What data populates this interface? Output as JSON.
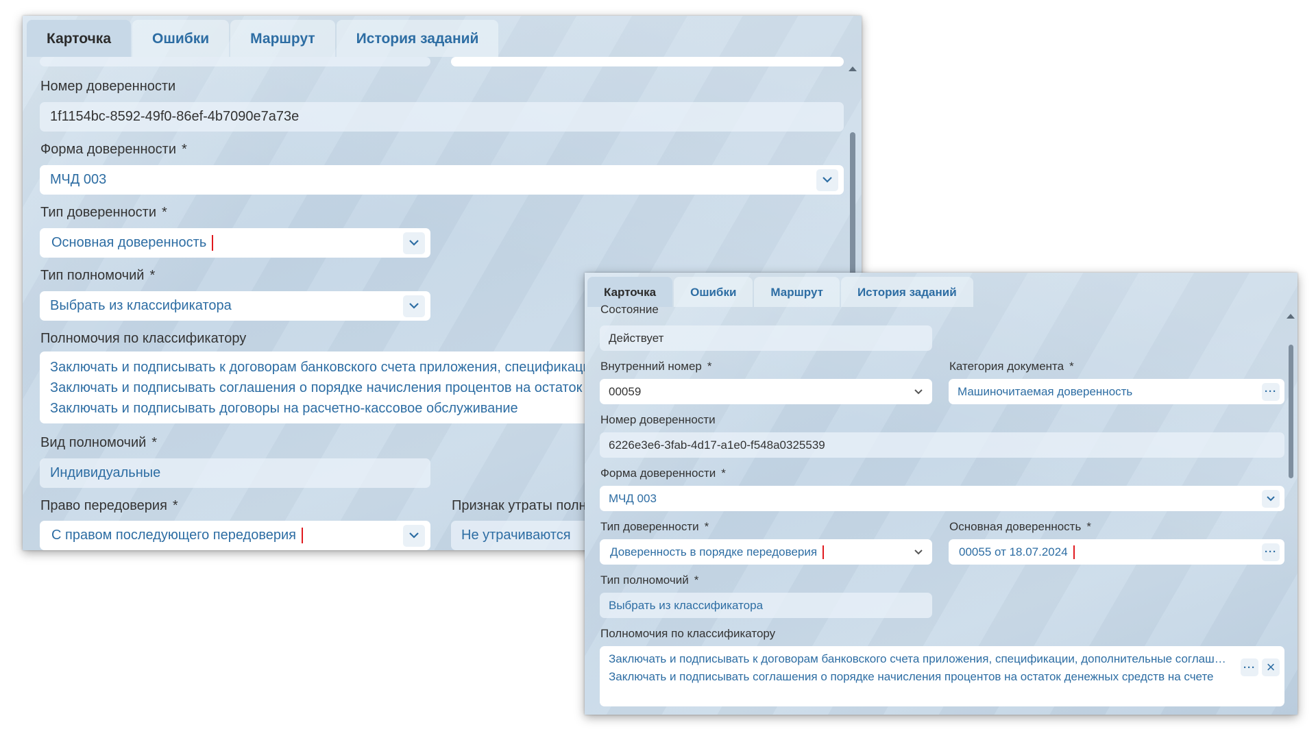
{
  "panel1": {
    "tabs": [
      "Карточка",
      "Ошибки",
      "Маршрут",
      "История заданий"
    ],
    "active_tab": 0,
    "fields": {
      "poa_number": {
        "label": "Номер доверенности",
        "value": "1f1154bc-8592-49f0-86ef-4b7090e7a73e"
      },
      "poa_form": {
        "label": "Форма доверенности",
        "value": "МЧД 003"
      },
      "poa_type": {
        "label": "Тип доверенности",
        "value": "Основная доверенность"
      },
      "authority_type": {
        "label": "Тип полномочий",
        "value": "Выбрать из классификатора"
      },
      "classifier_powers": {
        "label": "Полномочия по классификатору",
        "items": [
          "Заключать и подписывать к договорам банковского счета приложения, спецификации, дополнительные соглашения",
          "Заключать и подписывать соглашения о порядке начисления процентов на остаток денежных средств",
          "Заключать и подписывать договоры на расчетно-кассовое обслуживание"
        ]
      },
      "powers_kind": {
        "label": "Вид полномочий",
        "value": "Индивидуальные"
      },
      "redelegation_right": {
        "label": "Право передоверия",
        "value": "С правом последующего передоверия"
      },
      "loss_sign": {
        "label": "Признак утраты полномочий",
        "value": "Не утрачиваются"
      }
    },
    "required_mark": "*"
  },
  "panel2": {
    "tabs": [
      "Карточка",
      "Ошибки",
      "Маршрут",
      "История заданий"
    ],
    "active_tab": 0,
    "fields": {
      "state": {
        "label": "Состояние",
        "value": "Действует"
      },
      "internal_number": {
        "label": "Внутренний номер",
        "value": "00059"
      },
      "doc_category": {
        "label": "Категория документа",
        "value": "Машиночитаемая доверенность"
      },
      "poa_number": {
        "label": "Номер доверенности",
        "value": "6226e3e6-3fab-4d17-a1e0-f548a0325539"
      },
      "poa_form": {
        "label": "Форма доверенности",
        "value": "МЧД 003"
      },
      "poa_type": {
        "label": "Тип доверенности",
        "value": "Доверенность в порядке передоверия"
      },
      "main_poa": {
        "label": "Основная доверенность",
        "value": "00055 от 18.07.2024"
      },
      "authority_type": {
        "label": "Тип полномочий",
        "value": "Выбрать из классификатора"
      },
      "classifier_powers": {
        "label": "Полномочия по классификатору",
        "items": [
          "Заключать и подписывать к договорам банковского счета приложения, спецификации, дополнительные соглашения",
          "Заключать и подписывать соглашения о порядке начисления процентов на остаток денежных средств на счете"
        ]
      }
    },
    "required_mark": "*",
    "icons": {
      "dropdown": "chevron-down-icon",
      "ellipsis": "ellipsis-icon",
      "clear": "close-icon"
    }
  },
  "colors": {
    "accent_text": "#2d6da3",
    "highlight_border": "#e0191e",
    "label_text": "#333333"
  }
}
